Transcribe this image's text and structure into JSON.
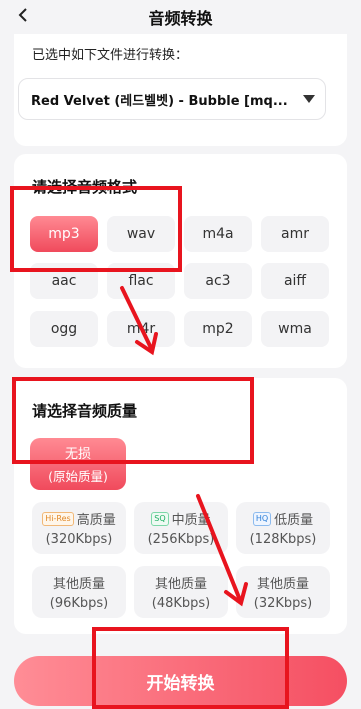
{
  "header": {
    "title": "音频转换"
  },
  "file_section": {
    "label": "已选中如下文件进行转换：",
    "selected_file": "Red Velvet (레드벨벳) - Bubble [mq..."
  },
  "format_section": {
    "heading": "请选择音频格式",
    "selected": "mp3",
    "formats": [
      "mp3",
      "wav",
      "m4a",
      "amr",
      "aac",
      "flac",
      "ac3",
      "aiff",
      "ogg",
      "m4r",
      "mp2",
      "wma"
    ]
  },
  "quality_section": {
    "heading": "请选择音频质量",
    "lossless": {
      "label": "无损",
      "sub": "(原始质量)"
    },
    "options": [
      {
        "tag": "Hi-Res",
        "label": "高质量",
        "bitrate": "(320Kbps)"
      },
      {
        "tag": "SQ",
        "label": "中质量",
        "bitrate": "(256Kbps)"
      },
      {
        "tag": "HQ",
        "label": "低质量",
        "bitrate": "(128Kbps)"
      },
      {
        "tag": "",
        "label": "其他质量",
        "bitrate": "(96Kbps)"
      },
      {
        "tag": "",
        "label": "其他质量",
        "bitrate": "(48Kbps)"
      },
      {
        "tag": "",
        "label": "其他质量",
        "bitrate": "(32Kbps)"
      }
    ]
  },
  "start_button": {
    "label": "开始转换"
  },
  "colors": {
    "accent": "#f04a5c",
    "annotation": "#e8141e"
  }
}
